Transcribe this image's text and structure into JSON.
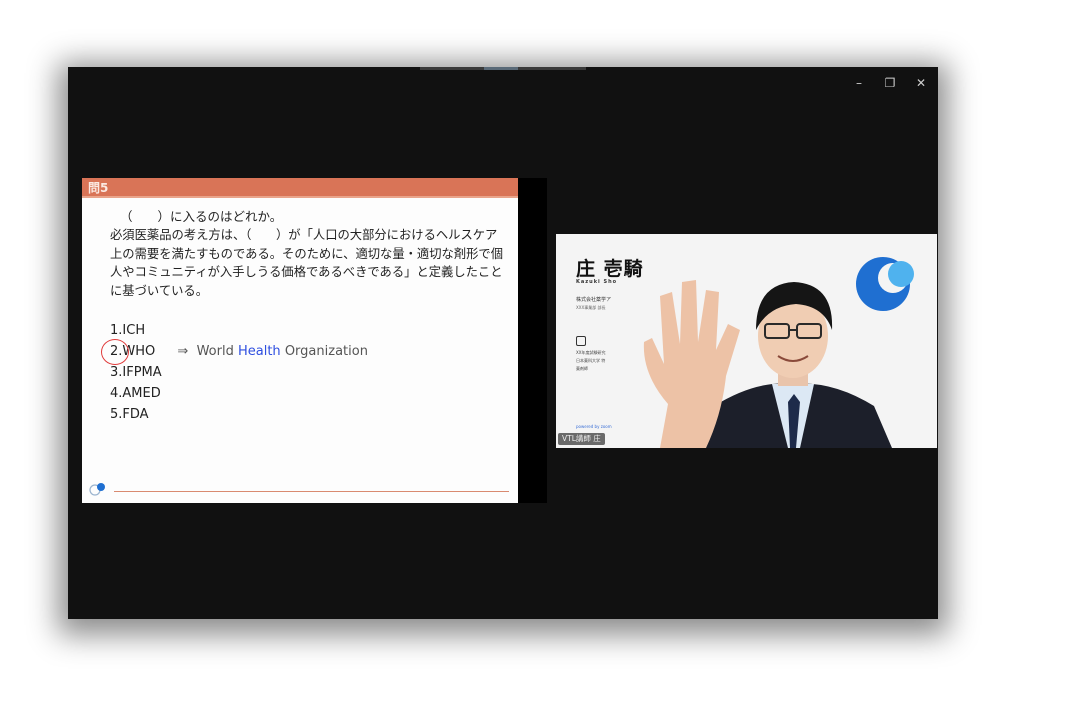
{
  "window": {
    "controls": {
      "minimize": "–",
      "restore": "❐",
      "close": "✕"
    }
  },
  "slide": {
    "header": "問5",
    "question_line": "（　　）に入るのはどれか。",
    "body": "必須医薬品の考え方は、（　　）が「人口の大部分におけるヘルスケア上の需要を満たすものである。そのために、適切な量・適切な剤形で個人やコミュニティが入手しうる価格であるべきである」と定義したことに基づいている。",
    "options": [
      "1.ICH",
      "2.WHO",
      "3.IFPMA",
      "4.AMED",
      "5.FDA"
    ],
    "circled_option_index": 1,
    "annotation": {
      "arrow": "⇒",
      "word1": "World",
      "word2": "Health",
      "word3": "Organization"
    }
  },
  "video": {
    "name_tag": "VTL講師 庄"
  },
  "colors": {
    "slide_header": "#d97457",
    "annotation_highlight": "#2f4fe0",
    "circle": "#e03b3b",
    "logo_blue": "#1f6fd1",
    "logo_light": "#4fb2ee"
  }
}
